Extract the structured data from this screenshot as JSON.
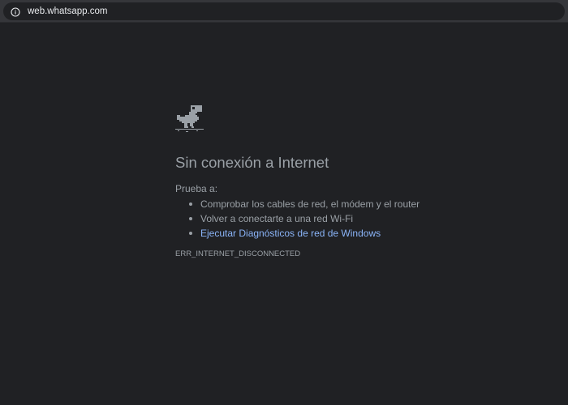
{
  "address_bar": {
    "url": "web.whatsapp.com",
    "info_icon": "info-icon"
  },
  "error_page": {
    "icon": "offline-dinosaur-icon",
    "title": "Sin conexión a Internet",
    "try_label": "Prueba a:",
    "suggestions": [
      {
        "text": "Comprobar los cables de red, el módem y el router",
        "is_link": false
      },
      {
        "text": "Volver a conectarte a una red Wi-Fi",
        "is_link": false
      },
      {
        "text": "Ejecutar Diagnósticos de red de Windows",
        "is_link": true
      }
    ],
    "error_code": "ERR_INTERNET_DISCONNECTED"
  },
  "colors": {
    "background": "#202124",
    "text": "#9aa0a6",
    "link": "#8ab4f8",
    "toolbar": "#35363a"
  }
}
